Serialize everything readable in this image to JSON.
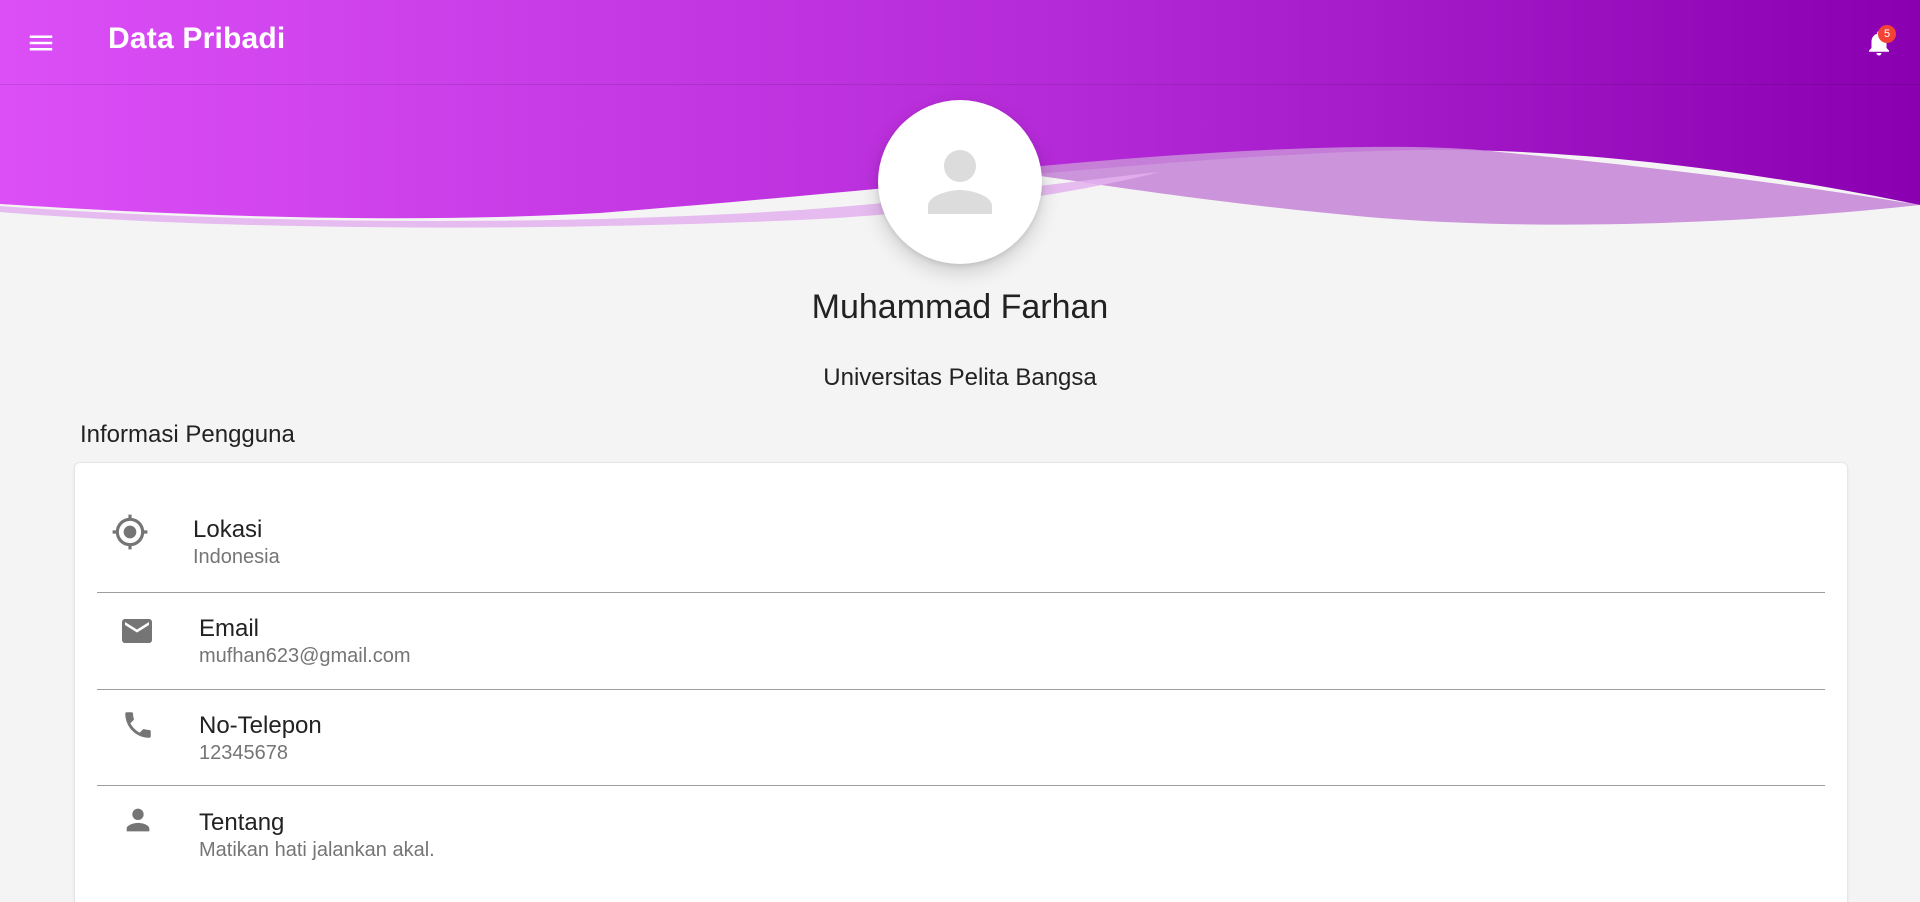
{
  "app_bar": {
    "title": "Data Pribadi",
    "notification_count": "5"
  },
  "profile": {
    "name": "Muhammad Farhan",
    "organization": "Universitas Pelita Bangsa"
  },
  "section": {
    "title": "Informasi Pengguna"
  },
  "info_items": [
    {
      "icon": "location-target-icon",
      "label": "Lokasi",
      "value": "Indonesia"
    },
    {
      "icon": "email-icon",
      "label": "Email",
      "value": "mufhan623@gmail.com"
    },
    {
      "icon": "phone-icon",
      "label": "No-Telepon",
      "value": "12345678"
    },
    {
      "icon": "person-icon",
      "label": "Tentang",
      "value": "Matikan hati jalankan akal."
    }
  ],
  "colors": {
    "gradient_start": "#dc4ff7",
    "gradient_end": "#8a00b0",
    "background": "#f4f4f4",
    "icon_gray": "#757575",
    "badge_red": "#f44336"
  }
}
